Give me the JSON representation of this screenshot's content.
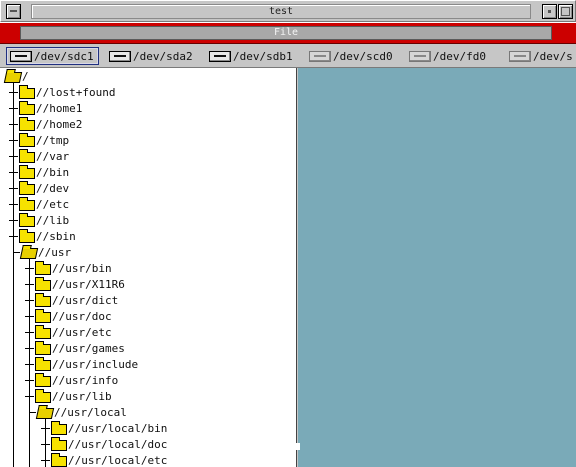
{
  "window": {
    "title": "test"
  },
  "menubar": {
    "file_label": "File"
  },
  "devices": [
    {
      "label": "/dev/sdc1",
      "icon": "drive-icon",
      "selected": true
    },
    {
      "label": "/dev/sda2",
      "icon": "drive-icon",
      "selected": false
    },
    {
      "label": "/dev/sdb1",
      "icon": "drive-icon",
      "selected": false
    },
    {
      "label": "/dev/scd0",
      "icon": "cdrom-icon",
      "selected": false
    },
    {
      "label": "/dev/fd0",
      "icon": "floppy-icon",
      "selected": false
    },
    {
      "label": "/dev/s",
      "icon": "drive-icon",
      "selected": false
    }
  ],
  "tree": {
    "root": "/",
    "items": [
      {
        "label": "//lost+found"
      },
      {
        "label": "//home1"
      },
      {
        "label": "//home2"
      },
      {
        "label": "//tmp"
      },
      {
        "label": "//var"
      },
      {
        "label": "//bin"
      },
      {
        "label": "//dev"
      },
      {
        "label": "//etc"
      },
      {
        "label": "//lib"
      },
      {
        "label": "//sbin"
      },
      {
        "label": "//usr"
      },
      {
        "label": "//usr/bin"
      },
      {
        "label": "//usr/X11R6"
      },
      {
        "label": "//usr/dict"
      },
      {
        "label": "//usr/doc"
      },
      {
        "label": "//usr/etc"
      },
      {
        "label": "//usr/games"
      },
      {
        "label": "//usr/include"
      },
      {
        "label": "//usr/info"
      },
      {
        "label": "//usr/lib"
      },
      {
        "label": "//usr/local"
      },
      {
        "label": "//usr/local/bin"
      },
      {
        "label": "//usr/local/doc"
      },
      {
        "label": "//usr/local/etc"
      }
    ]
  },
  "colors": {
    "menubar": "#cc0000",
    "right_pane": "#7aaab8",
    "folder": "#f6e200"
  }
}
